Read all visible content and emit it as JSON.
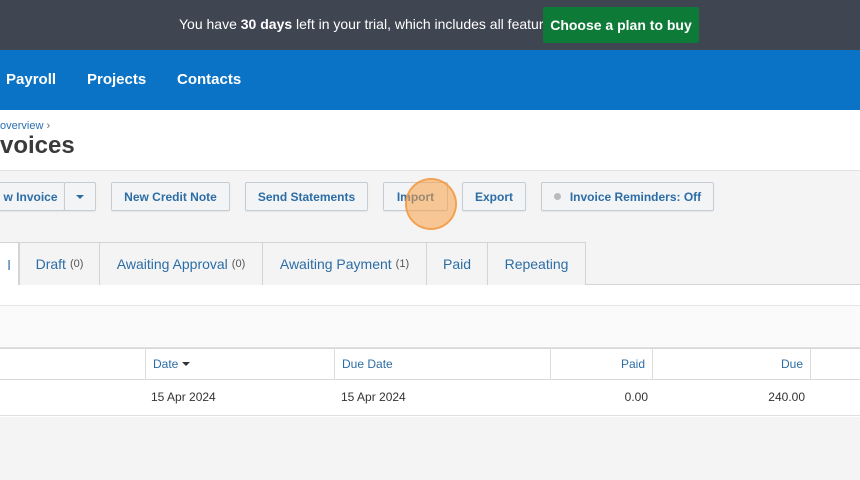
{
  "trial": {
    "prefix": "You have ",
    "days": "30 days",
    "suffix": " left in your trial, which includes all features",
    "button": "Choose a plan to buy"
  },
  "nav": {
    "items": [
      "Payroll",
      "Projects",
      "Contacts"
    ]
  },
  "header": {
    "breadcrumb": "overview",
    "breadcrumb_sep": "›",
    "title": "voices"
  },
  "toolbar": {
    "new_invoice": "w Invoice",
    "new_credit_note": "New Credit Note",
    "send_statements": "Send Statements",
    "import": "Import",
    "export": "Export",
    "reminders": "Invoice Reminders: Off"
  },
  "tabs": [
    {
      "label": "l",
      "count": ""
    },
    {
      "label": "Draft",
      "count": "(0)"
    },
    {
      "label": "Awaiting Approval",
      "count": "(0)"
    },
    {
      "label": "Awaiting Payment",
      "count": "(1)"
    },
    {
      "label": "Paid",
      "count": ""
    },
    {
      "label": "Repeating",
      "count": ""
    }
  ],
  "table": {
    "columns": [
      "Date",
      "Due Date",
      "Paid",
      "Due"
    ],
    "rows": [
      {
        "date": "15 Apr 2024",
        "due_date": "15 Apr 2024",
        "paid": "0.00",
        "due": "240.00"
      }
    ]
  },
  "colors": {
    "trial_bar": "#3f4551",
    "buy_button": "#0e7a38",
    "nav_bar": "#0b73c5",
    "link": "#2c6da6",
    "click_indicator": "#f5a04a"
  },
  "icons": {
    "dropdown": "chevron-down-icon",
    "status_dot": "dot-icon",
    "sort": "sort-desc-icon"
  }
}
